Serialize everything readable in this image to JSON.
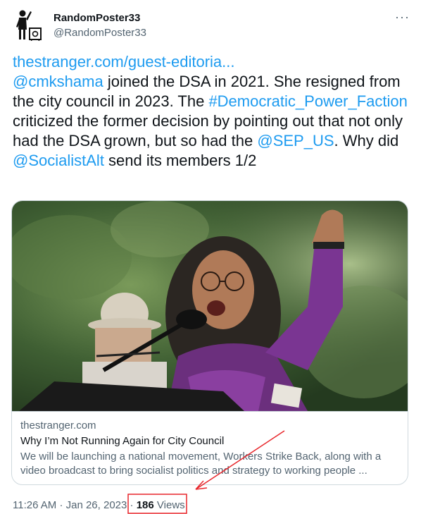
{
  "author": {
    "display_name": "RandomPoster33",
    "handle": "@RandomPoster33"
  },
  "tweet": {
    "link_text": "thestranger.com/guest-editoria...",
    "mention_1": "@cmkshama",
    "text_1": " joined the DSA in 2021. She resigned from the city council in 2023. The ",
    "hashtag": "#Democratic_Power_Faction",
    "text_2": " criticized the former decision by pointing out that not only had the DSA grown, but so had the ",
    "mention_2": "@SEP_US",
    "text_3": ". Why did ",
    "mention_3": "@SocialistAlt",
    "text_4": " send its members 1/2"
  },
  "card": {
    "domain": "thestranger.com",
    "title": "Why I’m Not Running Again for City Council",
    "description": "We will be launching a national movement, Workers Strike Back, along with a video broadcast to bring socialist politics and strategy to working people ..."
  },
  "footer": {
    "time": "11:26 AM",
    "separator": "·",
    "date": "Jan 26, 2023",
    "views_count": "186",
    "views_label": "Views"
  },
  "icons": {
    "more": "more-icon",
    "avatar": "person-with-safe-icon"
  },
  "colors": {
    "link": "#1d9bf0",
    "annotation": "#e8262b"
  }
}
